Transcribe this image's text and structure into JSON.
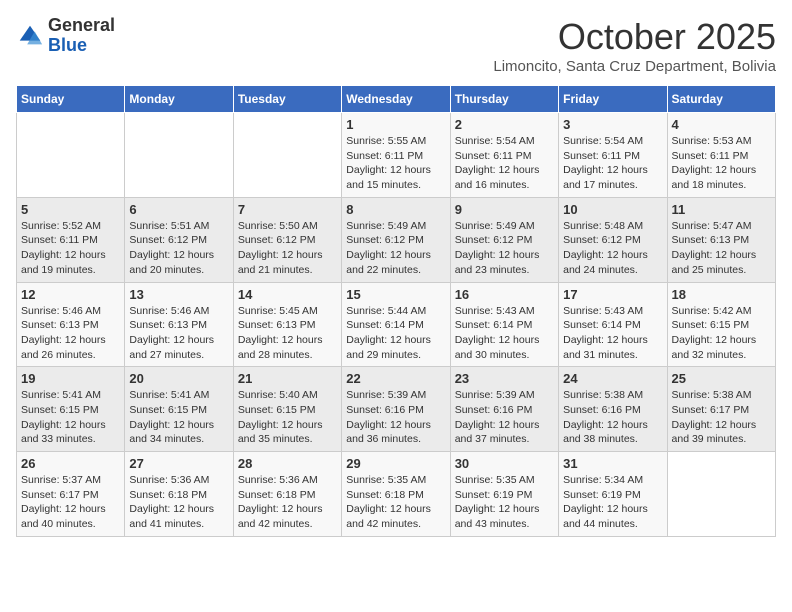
{
  "logo": {
    "general": "General",
    "blue": "Blue"
  },
  "header": {
    "month": "October 2025",
    "location": "Limoncito, Santa Cruz Department, Bolivia"
  },
  "days_of_week": [
    "Sunday",
    "Monday",
    "Tuesday",
    "Wednesday",
    "Thursday",
    "Friday",
    "Saturday"
  ],
  "weeks": [
    [
      {
        "day": "",
        "info": ""
      },
      {
        "day": "",
        "info": ""
      },
      {
        "day": "",
        "info": ""
      },
      {
        "day": "1",
        "info": "Sunrise: 5:55 AM\nSunset: 6:11 PM\nDaylight: 12 hours\nand 15 minutes."
      },
      {
        "day": "2",
        "info": "Sunrise: 5:54 AM\nSunset: 6:11 PM\nDaylight: 12 hours\nand 16 minutes."
      },
      {
        "day": "3",
        "info": "Sunrise: 5:54 AM\nSunset: 6:11 PM\nDaylight: 12 hours\nand 17 minutes."
      },
      {
        "day": "4",
        "info": "Sunrise: 5:53 AM\nSunset: 6:11 PM\nDaylight: 12 hours\nand 18 minutes."
      }
    ],
    [
      {
        "day": "5",
        "info": "Sunrise: 5:52 AM\nSunset: 6:11 PM\nDaylight: 12 hours\nand 19 minutes."
      },
      {
        "day": "6",
        "info": "Sunrise: 5:51 AM\nSunset: 6:12 PM\nDaylight: 12 hours\nand 20 minutes."
      },
      {
        "day": "7",
        "info": "Sunrise: 5:50 AM\nSunset: 6:12 PM\nDaylight: 12 hours\nand 21 minutes."
      },
      {
        "day": "8",
        "info": "Sunrise: 5:49 AM\nSunset: 6:12 PM\nDaylight: 12 hours\nand 22 minutes."
      },
      {
        "day": "9",
        "info": "Sunrise: 5:49 AM\nSunset: 6:12 PM\nDaylight: 12 hours\nand 23 minutes."
      },
      {
        "day": "10",
        "info": "Sunrise: 5:48 AM\nSunset: 6:12 PM\nDaylight: 12 hours\nand 24 minutes."
      },
      {
        "day": "11",
        "info": "Sunrise: 5:47 AM\nSunset: 6:13 PM\nDaylight: 12 hours\nand 25 minutes."
      }
    ],
    [
      {
        "day": "12",
        "info": "Sunrise: 5:46 AM\nSunset: 6:13 PM\nDaylight: 12 hours\nand 26 minutes."
      },
      {
        "day": "13",
        "info": "Sunrise: 5:46 AM\nSunset: 6:13 PM\nDaylight: 12 hours\nand 27 minutes."
      },
      {
        "day": "14",
        "info": "Sunrise: 5:45 AM\nSunset: 6:13 PM\nDaylight: 12 hours\nand 28 minutes."
      },
      {
        "day": "15",
        "info": "Sunrise: 5:44 AM\nSunset: 6:14 PM\nDaylight: 12 hours\nand 29 minutes."
      },
      {
        "day": "16",
        "info": "Sunrise: 5:43 AM\nSunset: 6:14 PM\nDaylight: 12 hours\nand 30 minutes."
      },
      {
        "day": "17",
        "info": "Sunrise: 5:43 AM\nSunset: 6:14 PM\nDaylight: 12 hours\nand 31 minutes."
      },
      {
        "day": "18",
        "info": "Sunrise: 5:42 AM\nSunset: 6:15 PM\nDaylight: 12 hours\nand 32 minutes."
      }
    ],
    [
      {
        "day": "19",
        "info": "Sunrise: 5:41 AM\nSunset: 6:15 PM\nDaylight: 12 hours\nand 33 minutes."
      },
      {
        "day": "20",
        "info": "Sunrise: 5:41 AM\nSunset: 6:15 PM\nDaylight: 12 hours\nand 34 minutes."
      },
      {
        "day": "21",
        "info": "Sunrise: 5:40 AM\nSunset: 6:15 PM\nDaylight: 12 hours\nand 35 minutes."
      },
      {
        "day": "22",
        "info": "Sunrise: 5:39 AM\nSunset: 6:16 PM\nDaylight: 12 hours\nand 36 minutes."
      },
      {
        "day": "23",
        "info": "Sunrise: 5:39 AM\nSunset: 6:16 PM\nDaylight: 12 hours\nand 37 minutes."
      },
      {
        "day": "24",
        "info": "Sunrise: 5:38 AM\nSunset: 6:16 PM\nDaylight: 12 hours\nand 38 minutes."
      },
      {
        "day": "25",
        "info": "Sunrise: 5:38 AM\nSunset: 6:17 PM\nDaylight: 12 hours\nand 39 minutes."
      }
    ],
    [
      {
        "day": "26",
        "info": "Sunrise: 5:37 AM\nSunset: 6:17 PM\nDaylight: 12 hours\nand 40 minutes."
      },
      {
        "day": "27",
        "info": "Sunrise: 5:36 AM\nSunset: 6:18 PM\nDaylight: 12 hours\nand 41 minutes."
      },
      {
        "day": "28",
        "info": "Sunrise: 5:36 AM\nSunset: 6:18 PM\nDaylight: 12 hours\nand 42 minutes."
      },
      {
        "day": "29",
        "info": "Sunrise: 5:35 AM\nSunset: 6:18 PM\nDaylight: 12 hours\nand 42 minutes."
      },
      {
        "day": "30",
        "info": "Sunrise: 5:35 AM\nSunset: 6:19 PM\nDaylight: 12 hours\nand 43 minutes."
      },
      {
        "day": "31",
        "info": "Sunrise: 5:34 AM\nSunset: 6:19 PM\nDaylight: 12 hours\nand 44 minutes."
      },
      {
        "day": "",
        "info": ""
      }
    ]
  ]
}
